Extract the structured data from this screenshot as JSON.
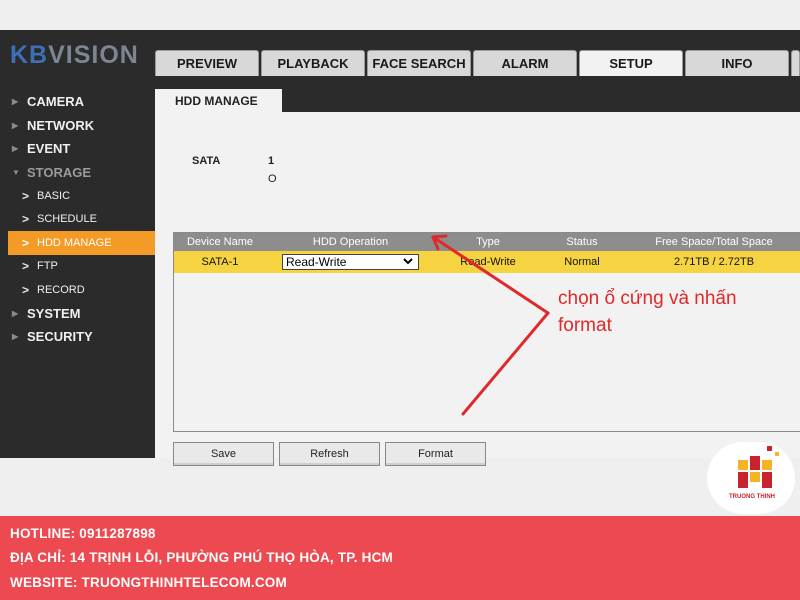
{
  "brand": {
    "logo_a": "KB",
    "logo_b": "VISION"
  },
  "tabs": [
    "PREVIEW",
    "PLAYBACK",
    "FACE SEARCH",
    "ALARM",
    "SETUP",
    "INFO"
  ],
  "sidebar": {
    "camera": "CAMERA",
    "network": "NETWORK",
    "event": "EVENT",
    "storage": "STORAGE",
    "basic": "BASIC",
    "schedule": "SCHEDULE",
    "hdd_manage": "HDD MANAGE",
    "ftp": "FTP",
    "record": "RECORD",
    "system": "SYSTEM",
    "security": "SECURITY"
  },
  "page": {
    "title": "HDD MANAGE",
    "sata_label": "SATA",
    "sata_num": "1",
    "sata_dot": "O"
  },
  "table": {
    "headers": [
      "Device Name",
      "HDD Operation",
      "Type",
      "Status",
      "Free Space/Total Space"
    ],
    "row": {
      "device": "SATA-1",
      "operation": "Read-Write",
      "type": "Read-Write",
      "status": "Normal",
      "space": "2.71TB / 2.72TB"
    }
  },
  "buttons": {
    "save": "Save",
    "refresh": "Refresh",
    "format": "Format"
  },
  "annotation": {
    "line1": "chọn ổ cứng và nhấn",
    "line2": "format"
  },
  "corner_logo": {
    "text": "TRUONG THINH"
  },
  "footer": {
    "hotline": "HOTLINE: 0911287898",
    "address": "ĐỊA CHỈ: 14 TRỊNH LỖI, PHƯỜNG PHÚ THỌ HÒA, TP. HCM",
    "website": "WEBSITE: TRUONGTHINHTELECOM.COM"
  },
  "colors": {
    "accent": "#f49a26",
    "row_highlight": "#f6d341",
    "annotation": "#e0292a",
    "footer": "#ec4a50"
  }
}
